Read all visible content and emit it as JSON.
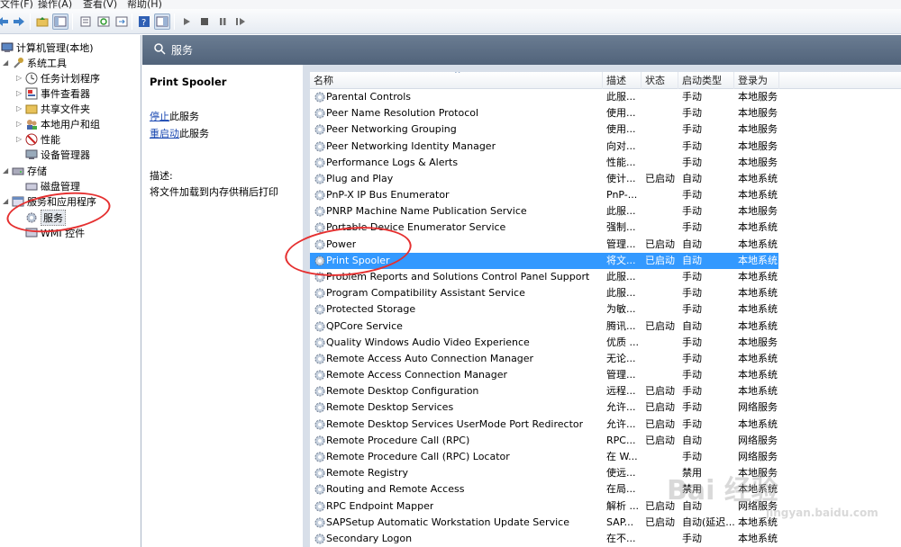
{
  "menubar": {
    "file": "文件(F)",
    "action": "操作(A)",
    "view": "查看(V)",
    "help": "帮助(H)"
  },
  "tree": {
    "root": "计算机管理(本地)",
    "system_tools": "系统工具",
    "task_scheduler": "任务计划程序",
    "event_viewer": "事件查看器",
    "shared_folders": "共享文件夹",
    "local_users": "本地用户和组",
    "performance": "性能",
    "device_manager": "设备管理器",
    "storage": "存储",
    "disk_management": "磁盘管理",
    "services_apps": "服务和应用程序",
    "services": "服务",
    "wmi": "WMI 控件"
  },
  "header": {
    "title": "服务"
  },
  "description_panel": {
    "service_name": "Print Spooler",
    "stop_link": "停止",
    "stop_suffix": "此服务",
    "restart_link": "重启动",
    "restart_suffix": "此服务",
    "desc_label": "描述:",
    "desc_text": "将文件加载到内存供稍后打印"
  },
  "columns": {
    "name": "名称",
    "desc": "描述",
    "status": "状态",
    "startup": "启动类型",
    "logon": "登录为"
  },
  "services": [
    {
      "name": "Parental Controls",
      "desc": "此服...",
      "status": "",
      "startup": "手动",
      "logon": "本地服务"
    },
    {
      "name": "Peer Name Resolution Protocol",
      "desc": "使用...",
      "status": "",
      "startup": "手动",
      "logon": "本地服务"
    },
    {
      "name": "Peer Networking Grouping",
      "desc": "使用...",
      "status": "",
      "startup": "手动",
      "logon": "本地服务"
    },
    {
      "name": "Peer Networking Identity Manager",
      "desc": "向对...",
      "status": "",
      "startup": "手动",
      "logon": "本地服务"
    },
    {
      "name": "Performance Logs & Alerts",
      "desc": "性能...",
      "status": "",
      "startup": "手动",
      "logon": "本地服务"
    },
    {
      "name": "Plug and Play",
      "desc": "使计...",
      "status": "已启动",
      "startup": "自动",
      "logon": "本地系统"
    },
    {
      "name": "PnP-X IP Bus Enumerator",
      "desc": "PnP-...",
      "status": "",
      "startup": "手动",
      "logon": "本地系统"
    },
    {
      "name": "PNRP Machine Name Publication Service",
      "desc": "此服...",
      "status": "",
      "startup": "手动",
      "logon": "本地服务"
    },
    {
      "name": "Portable Device Enumerator Service",
      "desc": "强制...",
      "status": "",
      "startup": "手动",
      "logon": "本地系统"
    },
    {
      "name": "Power",
      "desc": "管理...",
      "status": "已启动",
      "startup": "自动",
      "logon": "本地系统"
    },
    {
      "name": "Print Spooler",
      "desc": "将文...",
      "status": "已启动",
      "startup": "自动",
      "logon": "本地系统"
    },
    {
      "name": "Problem Reports and Solutions Control Panel Support",
      "desc": "此服...",
      "status": "",
      "startup": "手动",
      "logon": "本地系统"
    },
    {
      "name": "Program Compatibility Assistant Service",
      "desc": "此服...",
      "status": "",
      "startup": "手动",
      "logon": "本地系统"
    },
    {
      "name": "Protected Storage",
      "desc": "为敏...",
      "status": "",
      "startup": "手动",
      "logon": "本地系统"
    },
    {
      "name": "QPCore Service",
      "desc": "腾讯...",
      "status": "已启动",
      "startup": "自动",
      "logon": "本地系统"
    },
    {
      "name": "Quality Windows Audio Video Experience",
      "desc": "优质 ...",
      "status": "",
      "startup": "手动",
      "logon": "本地服务"
    },
    {
      "name": "Remote Access Auto Connection Manager",
      "desc": "无论...",
      "status": "",
      "startup": "手动",
      "logon": "本地系统"
    },
    {
      "name": "Remote Access Connection Manager",
      "desc": "管理...",
      "status": "",
      "startup": "手动",
      "logon": "本地系统"
    },
    {
      "name": "Remote Desktop Configuration",
      "desc": "远程...",
      "status": "已启动",
      "startup": "手动",
      "logon": "本地系统"
    },
    {
      "name": "Remote Desktop Services",
      "desc": "允许...",
      "status": "已启动",
      "startup": "手动",
      "logon": "网络服务"
    },
    {
      "name": "Remote Desktop Services UserMode Port Redirector",
      "desc": "允许...",
      "status": "已启动",
      "startup": "手动",
      "logon": "本地系统"
    },
    {
      "name": "Remote Procedure Call (RPC)",
      "desc": "RPC...",
      "status": "已启动",
      "startup": "自动",
      "logon": "网络服务"
    },
    {
      "name": "Remote Procedure Call (RPC) Locator",
      "desc": "在 W...",
      "status": "",
      "startup": "手动",
      "logon": "网络服务"
    },
    {
      "name": "Remote Registry",
      "desc": "使远...",
      "status": "",
      "startup": "禁用",
      "logon": "本地服务"
    },
    {
      "name": "Routing and Remote Access",
      "desc": "在局...",
      "status": "",
      "startup": "禁用",
      "logon": "本地系统"
    },
    {
      "name": "RPC Endpoint Mapper",
      "desc": "解析 ...",
      "status": "已启动",
      "startup": "自动",
      "logon": "网络服务"
    },
    {
      "name": "SAPSetup Automatic Workstation Update Service",
      "desc": "SAP...",
      "status": "已启动",
      "startup": "自动(延迟...",
      "logon": "本地系统"
    },
    {
      "name": "Secondary Logon",
      "desc": "在不...",
      "status": "",
      "startup": "手动",
      "logon": "本地系统"
    }
  ],
  "selected_index": 10,
  "watermark": {
    "text": "Bai 经验",
    "url": "jingyan.baidu.com"
  },
  "colors": {
    "selection": "#3399ff",
    "annotation": "#e53030",
    "header": "#5a6c83"
  }
}
